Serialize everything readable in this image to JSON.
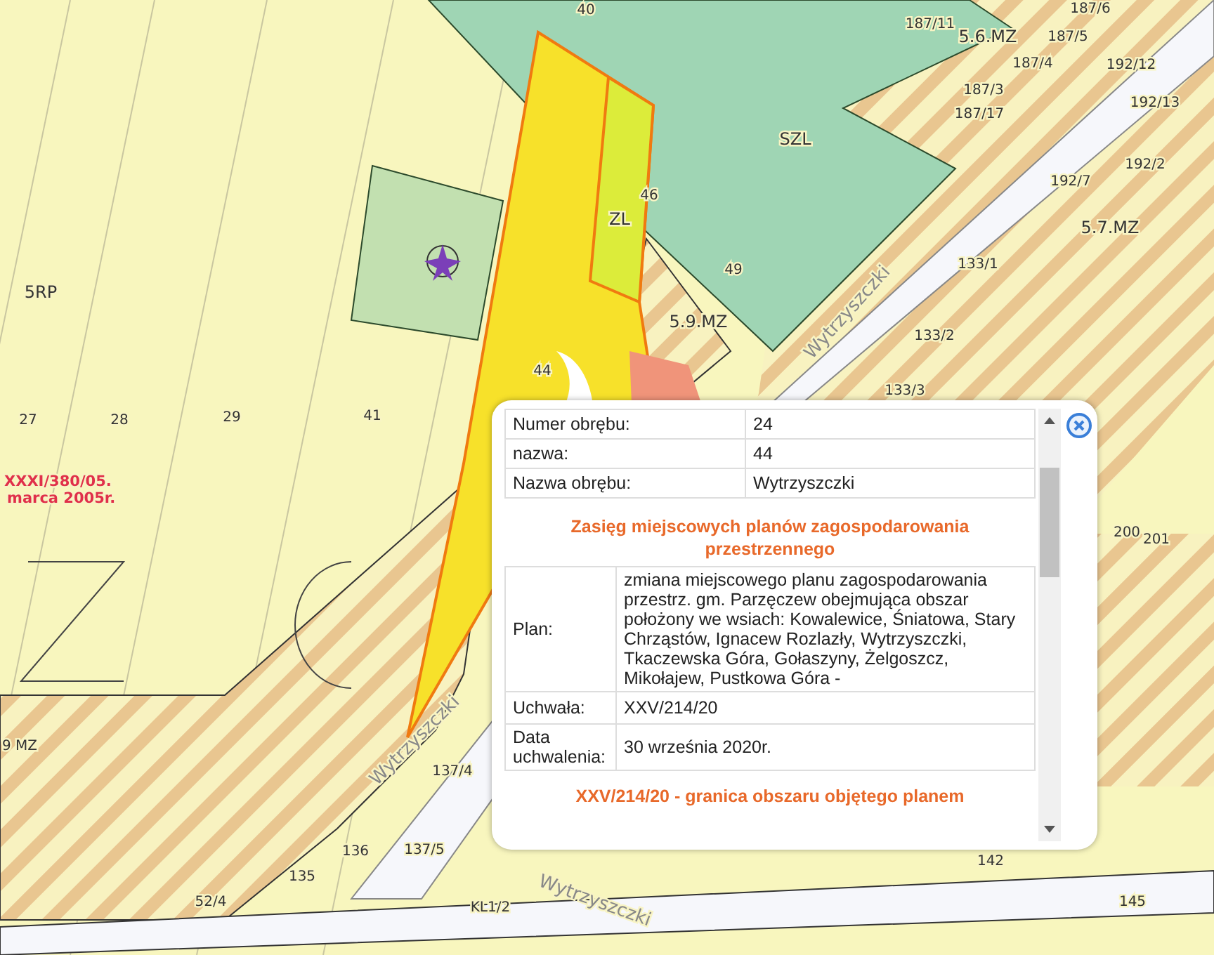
{
  "map": {
    "labels": [
      {
        "text": "40"
      },
      {
        "text": "187/11"
      },
      {
        "text": "187/6"
      },
      {
        "text": "5.6.MZ"
      },
      {
        "text": "187/5"
      },
      {
        "text": "187/4"
      },
      {
        "text": "187/3"
      },
      {
        "text": "187/17"
      },
      {
        "text": "192/12"
      },
      {
        "text": "192/13"
      },
      {
        "text": "192/2"
      },
      {
        "text": "192/7"
      },
      {
        "text": "5.7.MZ"
      },
      {
        "text": "SZL"
      },
      {
        "text": "ZL"
      },
      {
        "text": "46"
      },
      {
        "text": "49"
      },
      {
        "text": "5.9.MZ"
      },
      {
        "text": "Wytrzyszczki"
      },
      {
        "text": "133/1"
      },
      {
        "text": "133/2"
      },
      {
        "text": "133/3"
      },
      {
        "text": "5RP"
      },
      {
        "text": "44"
      },
      {
        "text": "27"
      },
      {
        "text": "28"
      },
      {
        "text": "29"
      },
      {
        "text": "41"
      },
      {
        "text": "9 MZ"
      },
      {
        "text": "137/4"
      },
      {
        "text": "Wytrzyszczki"
      },
      {
        "text": "136"
      },
      {
        "text": "137/5"
      },
      {
        "text": "135"
      },
      {
        "text": "52/4"
      },
      {
        "text": "KL1/2"
      },
      {
        "text": "Wytrzyszczki"
      },
      {
        "text": "200"
      },
      {
        "text": "201"
      },
      {
        "text": "142"
      },
      {
        "text": "145"
      }
    ],
    "plan_labels": [
      {
        "text": "XXXI/380/05."
      },
      {
        "text": "marca 2005r."
      }
    ]
  },
  "popup": {
    "parcel_rows": [
      {
        "label": "Numer obrębu:",
        "value": "24"
      },
      {
        "label": "nazwa:",
        "value": "44"
      },
      {
        "label": "Nazwa obrębu:",
        "value": "Wytrzyszczki"
      }
    ],
    "section_title": "Zasięg miejscowych planów zagospodarowania przestrzennego",
    "plan_rows": [
      {
        "label": "Plan:",
        "value": "zmiana miejscowego planu zagospodarowania przestrz. gm. Parzęczew obejmująca obszar położony we wsiach: Kowalewice, Śniatowa, Stary Chrząstów, Ignacew Rozlazły, Wytrzyszczki, Tkaczewska Góra, Gołaszyny, Żelgoszcz, Mikołajew, Pustkowa Góra -"
      },
      {
        "label": "Uchwała:",
        "value": "XXV/214/20"
      },
      {
        "label": "Data uchwalenia:",
        "value": "30 września 2020r."
      }
    ],
    "second_title": "XXV/214/20 - granica obszaru objętego planem"
  }
}
